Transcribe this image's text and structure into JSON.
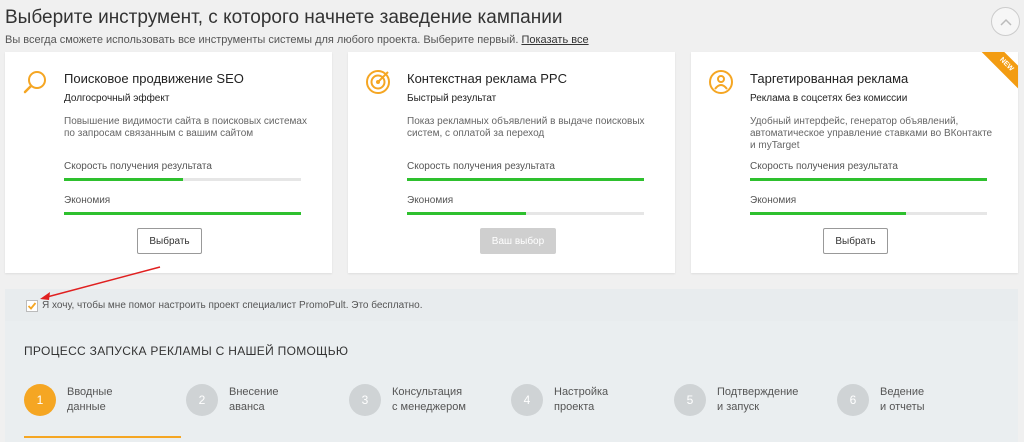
{
  "header": {
    "title": "Выберите инструмент, с которого начнете заведение кампании",
    "subtitle": "Вы всегда сможете использовать все инструменты системы для любого проекта. Выберите первый.",
    "show_all_link": "Показать все"
  },
  "cards": [
    {
      "icon": "search-icon",
      "title": "Поисковое продвижение SEO",
      "subtitle": "Долгосрочный эффект",
      "description": "Повышение видимости сайта в поисковых системах по запросам связанным с вашим сайтом",
      "metric1_label": "Скорость получения результата",
      "metric1_value": 0.5,
      "metric2_label": "Экономия",
      "metric2_value": 1.0,
      "button_label": "Выбрать",
      "selected": false
    },
    {
      "icon": "target-icon",
      "title": "Контекстная реклама PPC",
      "subtitle": "Быстрый результат",
      "description": "Показ рекламных объявлений в выдаче поисковых систем, с оплатой за переход",
      "metric1_label": "Скорость получения результата",
      "metric1_value": 1.0,
      "metric2_label": "Экономия",
      "metric2_value": 0.5,
      "button_label": "Ваш выбор",
      "selected": true
    },
    {
      "icon": "audience-icon",
      "title": "Таргетированная реклама",
      "subtitle": "Реклама в соцсетях без комиссии",
      "description": "Удобный интерфейс, генератор объявлений, автоматическое управление ставками во ВКонтакте и myTarget",
      "metric1_label": "Скорость получения результата",
      "metric1_value": 1.0,
      "metric2_label": "Экономия",
      "metric2_value": 0.66,
      "button_label": "Выбрать",
      "selected": false,
      "badge": "NEW"
    }
  ],
  "consent": {
    "checked": true,
    "text": "Я хочу, чтобы мне помог настроить проект специалист PromoPult. Это бесплатно."
  },
  "process": {
    "title": "ПРОЦЕСС ЗАПУСКА РЕКЛАМЫ С НАШЕЙ ПОМОЩЬЮ",
    "steps": [
      {
        "num": "1",
        "label": "Вводные\nданные",
        "active": true
      },
      {
        "num": "2",
        "label": "Внесение\nаванса",
        "active": false
      },
      {
        "num": "3",
        "label": "Консультация\nс менеджером",
        "active": false
      },
      {
        "num": "4",
        "label": "Настройка\nпроекта",
        "active": false
      },
      {
        "num": "5",
        "label": "Подтверждение\nи запуск",
        "active": false
      },
      {
        "num": "6",
        "label": "Ведение\nи отчеты",
        "active": false
      }
    ]
  },
  "colors": {
    "accent": "#f5a623",
    "progress": "#2ec02e",
    "annotation_arrow": "#e02020"
  }
}
